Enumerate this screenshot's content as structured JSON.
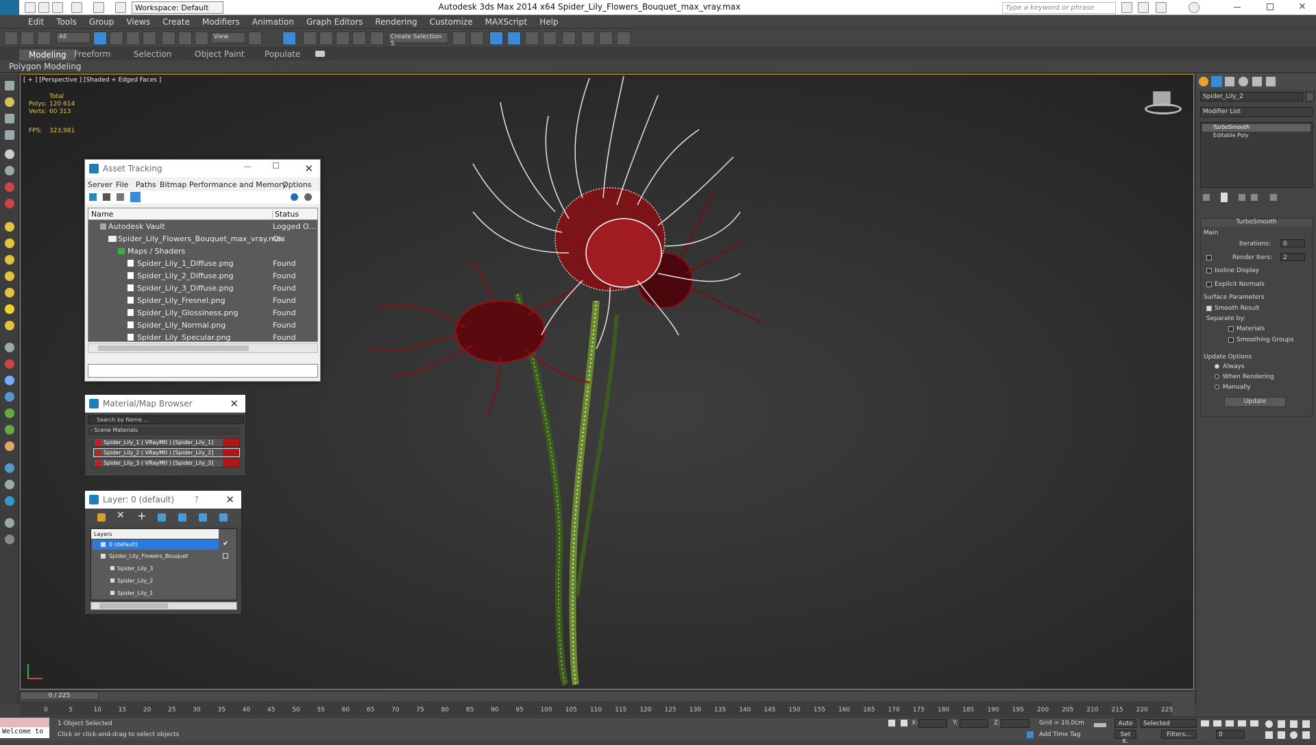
{
  "window": {
    "title": "Autodesk 3ds Max  2014 x64     Spider_Lily_Flowers_Bouquet_max_vray.max",
    "workspace": "Workspace: Default",
    "search_placeholder": "Type a keyword or phrase"
  },
  "menu": [
    "Edit",
    "Tools",
    "Group",
    "Views",
    "Create",
    "Modifiers",
    "Animation",
    "Graph Editors",
    "Rendering",
    "Customize",
    "MAXScript",
    "Help"
  ],
  "toolbar": {
    "selection_filter": "All",
    "ref_coord": "View",
    "named_selection": "Create Selection S"
  },
  "ribbon": {
    "tabs": [
      "Modeling",
      "Freeform",
      "Selection",
      "Object Paint",
      "Populate"
    ],
    "subtab": "Polygon Modeling"
  },
  "viewport": {
    "label": "[ + ] [Perspective ] [Shaded + Edged Faces ]",
    "total_label": "Total",
    "polys_label": "Polys:",
    "polys": "120 614",
    "verts_label": "Verts:",
    "verts": "60 313",
    "fps_label": "FPS:",
    "fps": "323,981"
  },
  "asset_tracking": {
    "title": "Asset Tracking",
    "menu": [
      "Server",
      "File",
      "Paths",
      "Bitmap Performance and Memory",
      "Options"
    ],
    "col_name": "Name",
    "col_status": "Status",
    "rows": [
      {
        "name": "Autodesk Vault",
        "status": "Logged O..."
      },
      {
        "name": "Spider_Lily_Flowers_Bouquet_max_vray.max",
        "status": "Ok"
      },
      {
        "name": "Maps / Shaders",
        "status": ""
      },
      {
        "name": "Spider_Lily_1_Diffuse.png",
        "status": "Found"
      },
      {
        "name": "Spider_Lily_2_Diffuse.png",
        "status": "Found"
      },
      {
        "name": "Spider_Lily_3_Diffuse.png",
        "status": "Found"
      },
      {
        "name": "Spider_Lily_Fresnel.png",
        "status": "Found"
      },
      {
        "name": "Spider_Lily_Glossiness.png",
        "status": "Found"
      },
      {
        "name": "Spider_Lily_Normal.png",
        "status": "Found"
      },
      {
        "name": "Spider_Lily_Specular.png",
        "status": "Found"
      }
    ]
  },
  "material_browser": {
    "title": "Material/Map Browser",
    "search": "Search by Name ...",
    "group": "- Scene Materials",
    "items": [
      "Spider_Lily_1  ( VRayMtl ) [Spider_Lily_1]",
      "Spider_Lily_2  ( VRayMtl ) [Spider_Lily_2]",
      "Spider_Lily_3  ( VRayMtl ) [Spider_Lily_3]"
    ]
  },
  "layer_panel": {
    "title": "Layer: 0 (default)",
    "help": "?",
    "header": "Layers",
    "items": [
      "0 (default)",
      "Spider_Lily_Flowers_Bouquet",
      "Spider_Lily_3",
      "Spider_Lily_2",
      "Spider_Lily_1"
    ]
  },
  "command_panel": {
    "object_name": "Spider_Lily_2",
    "modifier_list": "Modifier List",
    "stack": [
      "TurboSmooth",
      "Editable Poly"
    ],
    "rollout": "TurboSmooth",
    "main": "Main",
    "iterations_label": "Iterations:",
    "iterations": "0",
    "render_iters_label": "Render Iters:",
    "render_iters": "2",
    "isoline": "Isoline Display",
    "explicit_normals": "Explicit Normals",
    "surface_params": "Surface Parameters",
    "smooth_result": "Smooth Result",
    "separate_by": "Separate by:",
    "materials": "Materials",
    "smoothing_groups": "Smoothing Groups",
    "update_options": "Update Options",
    "always": "Always",
    "when_rendering": "When Rendering",
    "manually": "Manually",
    "update": "Update"
  },
  "timeline": {
    "frame": "0 / 225",
    "ticks": [
      "0",
      "5",
      "10",
      "15",
      "20",
      "25",
      "30",
      "35",
      "40",
      "45",
      "50",
      "55",
      "60",
      "65",
      "70",
      "75",
      "80",
      "85",
      "90",
      "95",
      "100",
      "105",
      "110",
      "115",
      "120",
      "125",
      "130",
      "135",
      "140",
      "145",
      "150",
      "155",
      "160",
      "165",
      "170",
      "175",
      "180",
      "185",
      "190",
      "195",
      "200",
      "205",
      "210",
      "215",
      "220",
      "225"
    ]
  },
  "status": {
    "maxscript": "Welcome to",
    "selected": "1 Object Selected",
    "prompt": "Click or click-and-drag to select objects",
    "x": "X:",
    "y": "Y:",
    "z": "Z:",
    "grid": "Grid = 10,0cm",
    "add_time_tag": "Add Time Tag",
    "auto": "Auto",
    "set_key": "Set K.",
    "key_filter": "Selected",
    "filters": "Filters...",
    "frame_field": "0"
  }
}
